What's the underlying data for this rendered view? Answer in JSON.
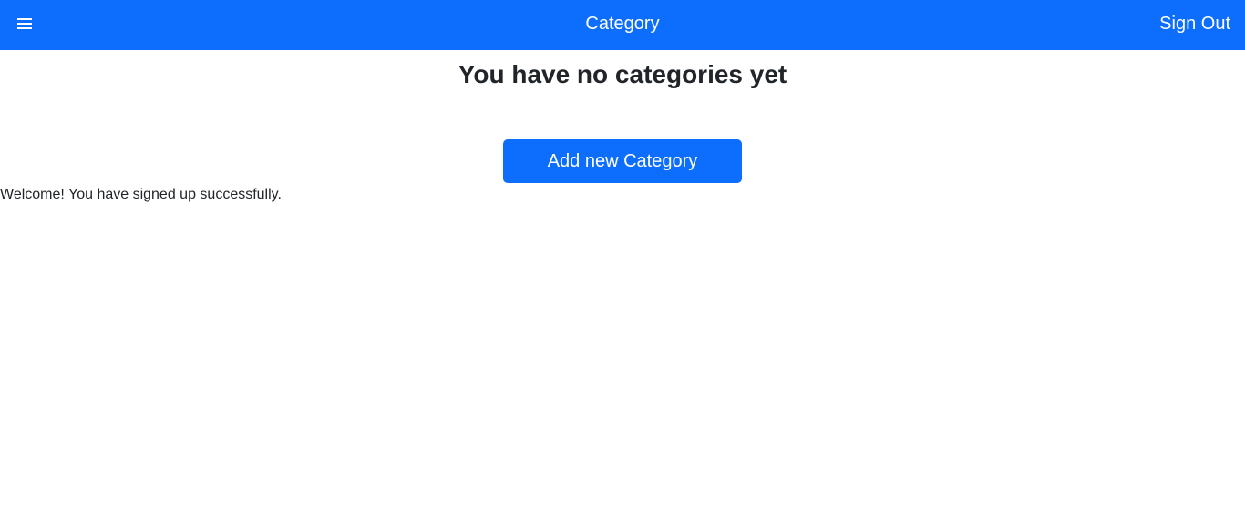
{
  "navbar": {
    "menu_icon": "hamburger-menu-icon",
    "title": "Category",
    "sign_out_label": "Sign Out",
    "background_color": "#0d6efd"
  },
  "main": {
    "empty_message": "You have no categories yet",
    "add_button_label": "Add new Category",
    "notice": "Welcome! You have signed up successfully."
  }
}
